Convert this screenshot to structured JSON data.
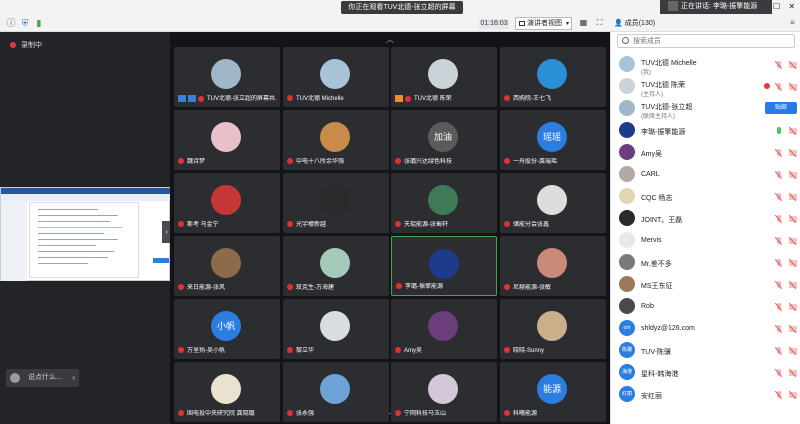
{
  "topbar": {
    "watch_banner": "你正在观看TUV北德-张立超的屏幕",
    "timer": "01:16:03",
    "view_button": "演讲者视图",
    "speaking": "正在讲话: 李璐-振擎能源",
    "members_title": "成员(130)"
  },
  "left": {
    "recording": "录制中",
    "chat_placeholder": "说点什么..."
  },
  "tiles": [
    {
      "name": "TUV北德-张立超的屏幕共...",
      "color": "#9fb7c9",
      "badges": true
    },
    {
      "name": "TUV北德 Michelle",
      "color": "#a9c3d6"
    },
    {
      "name": "TUV北德 陈荣",
      "color": "#c9d3d8",
      "badge_orange": true
    },
    {
      "name": "西购院-王七飞",
      "color": "#2a8fd6"
    },
    {
      "name": "魏诗梦",
      "color": "#e9c0c9"
    },
    {
      "name": "中电十八所余华强",
      "color": "#c98b4a"
    },
    {
      "name": "张璐兴达绿色科技",
      "color": "#5b5b5b",
      "text": "加油"
    },
    {
      "name": "一舟股份-龚瑞瑶",
      "color": "#2b7de0",
      "text": "瑶瑶"
    },
    {
      "name": "斯考 马金宁",
      "color": "#c73636"
    },
    {
      "name": "光宇檬新越",
      "color": "#2a2a2a"
    },
    {
      "name": "天琨能源-张蜀轩",
      "color": "#3d7a55"
    },
    {
      "name": "储能分会张鑫",
      "color": "#dcdcdc"
    },
    {
      "name": "来日能源-张风",
      "color": "#8c6b4a"
    },
    {
      "name": "玫克生-万海建",
      "color": "#a5c9b8"
    },
    {
      "name": "李璐-振擎能源",
      "color": "#1e3a8a",
      "active": true
    },
    {
      "name": "尼赫能源-张敏",
      "color": "#c98a7a"
    },
    {
      "name": "万里扬-吴小帆",
      "color": "#2b7de0",
      "text": "小帆"
    },
    {
      "name": "黎立华",
      "color": "#d8dde2"
    },
    {
      "name": "Amy吴",
      "color": "#6b3d7a"
    },
    {
      "name": "晓晓-Sunny",
      "color": "#c9b08a"
    },
    {
      "name": "国电投中央研究院 龚晓璐",
      "color": "#e9e2cf"
    },
    {
      "name": "张永强",
      "color": "#6da3d6"
    },
    {
      "name": "宁网科技马玉山",
      "color": "#d3c7d8"
    },
    {
      "name": "科曦能源",
      "color": "#2b7de0",
      "text": "能源"
    }
  ],
  "members": {
    "search_placeholder": "搜索成员",
    "action_label": "贴邮",
    "list": [
      {
        "name": "TUV北德 Michelle",
        "sub": "(我)",
        "color": "#a9c3d6",
        "status": "off"
      },
      {
        "name": "TUV北德 陈荣",
        "sub": "(主持人)",
        "color": "#c9d3d8",
        "status": "off",
        "rec": true
      },
      {
        "name": "TUV北德-张立超",
        "sub": "(联席主持人)",
        "color": "#9fb7c9",
        "status": "off",
        "action": true
      },
      {
        "name": "李璐-振擎能源",
        "sub": "",
        "color": "#1e3a8a",
        "status": "on"
      },
      {
        "name": "Amy吴",
        "sub": "",
        "color": "#6b3d7a",
        "status": "off"
      },
      {
        "name": "CARL",
        "sub": "",
        "color": "#b0aaa2",
        "status": "off"
      },
      {
        "name": "CQC 杨志",
        "sub": "",
        "color": "#e2d6b0",
        "status": "off"
      },
      {
        "name": "JOINT。王磊",
        "sub": "",
        "color": "#2a2a2a",
        "status": "off"
      },
      {
        "name": "Mervis",
        "sub": "",
        "color": "#e8e8ee",
        "status": "off"
      },
      {
        "name": "Mr.差不多",
        "sub": "",
        "color": "#7a7a7a",
        "status": "off"
      },
      {
        "name": "MS王东征",
        "sub": "",
        "color": "#9a7a5a",
        "status": "off"
      },
      {
        "name": "Rob",
        "sub": "",
        "color": "#4a4a4a",
        "status": "off"
      },
      {
        "name": "shldyz@126.com",
        "sub": "",
        "color": "#2b7de0",
        "text": "om",
        "status": "off"
      },
      {
        "name": "TUV-陈骥",
        "sub": "",
        "color": "#2b7de0",
        "text": "陈骥",
        "status": "off"
      },
      {
        "name": "星科-韩海港",
        "sub": "",
        "color": "#2b7de0",
        "text": "海港",
        "status": "off"
      },
      {
        "name": "安红丽",
        "sub": "",
        "color": "#2b7de0",
        "text": "红丽",
        "status": "off"
      }
    ]
  }
}
